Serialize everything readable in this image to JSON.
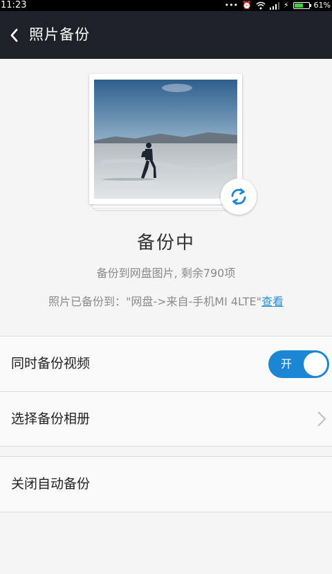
{
  "status_bar": {
    "time": "11:23",
    "battery": "61%",
    "battery_level": 0.61
  },
  "header": {
    "title": "照片备份"
  },
  "backup": {
    "status": "备份中",
    "progress_text": "备份到网盘图片, 剩余790项",
    "destination_text": "照片已备份到：\"网盘->来自-手机MI 4LTE\"",
    "view_link": "查看"
  },
  "settings": {
    "backup_video": {
      "label": "同时备份视频",
      "toggle_text": "开",
      "enabled": true
    },
    "select_album": {
      "label": "选择备份相册"
    },
    "disable_auto": {
      "label": "关闭自动备份"
    }
  },
  "colors": {
    "title_bar": "#1f2129",
    "accent": "#1b86d4",
    "link": "#2e8ed5",
    "background": "#f5f5f5"
  }
}
